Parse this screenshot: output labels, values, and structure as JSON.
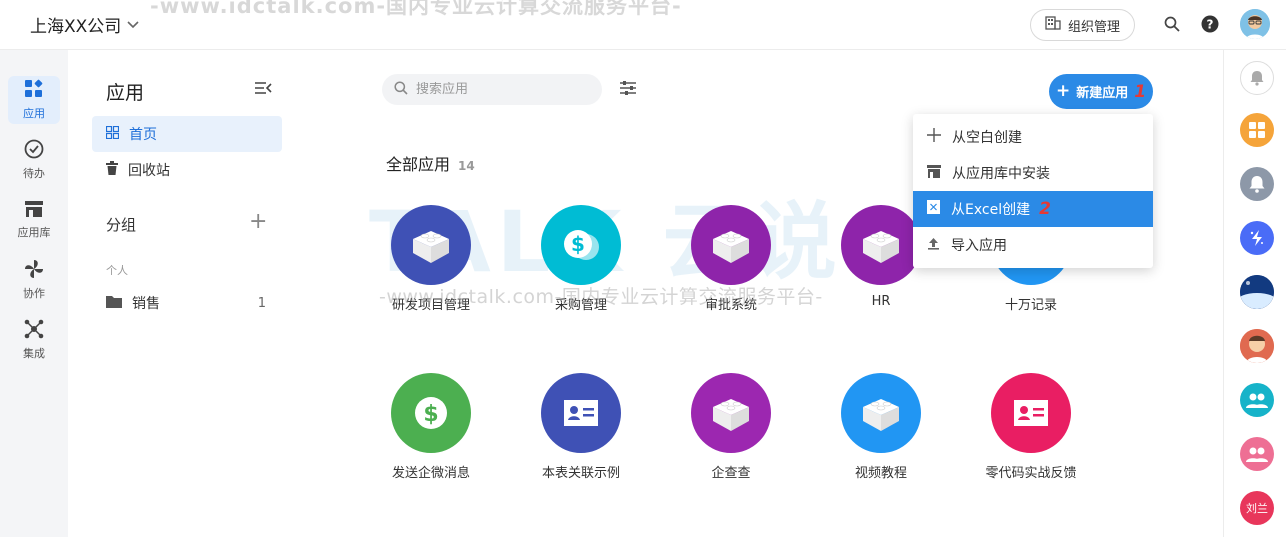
{
  "header": {
    "company": "上海XX公司",
    "watermark": "-www.idctalk.com-国内专业云计算交流服务平台-",
    "org_button": "组织管理"
  },
  "leftnav": {
    "items": [
      {
        "label": "应用",
        "icon": "apps-icon"
      },
      {
        "label": "待办",
        "icon": "check-circle-icon"
      },
      {
        "label": "应用库",
        "icon": "store-icon"
      },
      {
        "label": "协作",
        "icon": "pinwheel-icon"
      },
      {
        "label": "集成",
        "icon": "integration-icon"
      }
    ]
  },
  "sidebar": {
    "title": "应用",
    "items": [
      {
        "label": "首页"
      },
      {
        "label": "回收站"
      }
    ],
    "group_title": "分组",
    "personal_label": "个人",
    "sales": {
      "label": "销售",
      "count": "1"
    }
  },
  "main": {
    "search_placeholder": "搜索应用",
    "new_app_label": "新建应用",
    "step1": "1",
    "step2": "2",
    "all_apps_label": "全部应用",
    "all_apps_count": "14",
    "apps": [
      {
        "label": "研发项目管理",
        "color": "#3f51b5",
        "icon": "block-icon"
      },
      {
        "label": "采购管理",
        "color": "#00bcd4",
        "icon": "coins-icon"
      },
      {
        "label": "审批系统",
        "color": "#8e24aa",
        "icon": "block-icon"
      },
      {
        "label": "HR",
        "color": "#8e24aa",
        "icon": "block-icon"
      },
      {
        "label": "十万记录",
        "color": "#2196f3",
        "icon": "block-icon"
      },
      {
        "label": "发送企微消息",
        "color": "#4caf50",
        "icon": "dollar-icon"
      },
      {
        "label": "本表关联示例",
        "color": "#3f51b5",
        "icon": "id-card-icon"
      },
      {
        "label": "企查查",
        "color": "#9c27b0",
        "icon": "block-icon"
      },
      {
        "label": "视频教程",
        "color": "#2196f3",
        "icon": "block-icon"
      },
      {
        "label": "零代码实战反馈",
        "color": "#e91e63",
        "icon": "id-card-icon"
      }
    ],
    "watermark_mid": "-www.idctalk.com-国内专业云计算交流服务平台-",
    "watermark_brand": "TALK 云说"
  },
  "dropdown": {
    "items": [
      {
        "label": "从空白创建",
        "icon": "plus-icon"
      },
      {
        "label": "从应用库中安装",
        "icon": "store-icon"
      },
      {
        "label": "从Excel创建",
        "icon": "excel-icon"
      },
      {
        "label": "导入应用",
        "icon": "import-icon"
      }
    ]
  },
  "rightrail": {
    "user_badge": "刘兰"
  }
}
